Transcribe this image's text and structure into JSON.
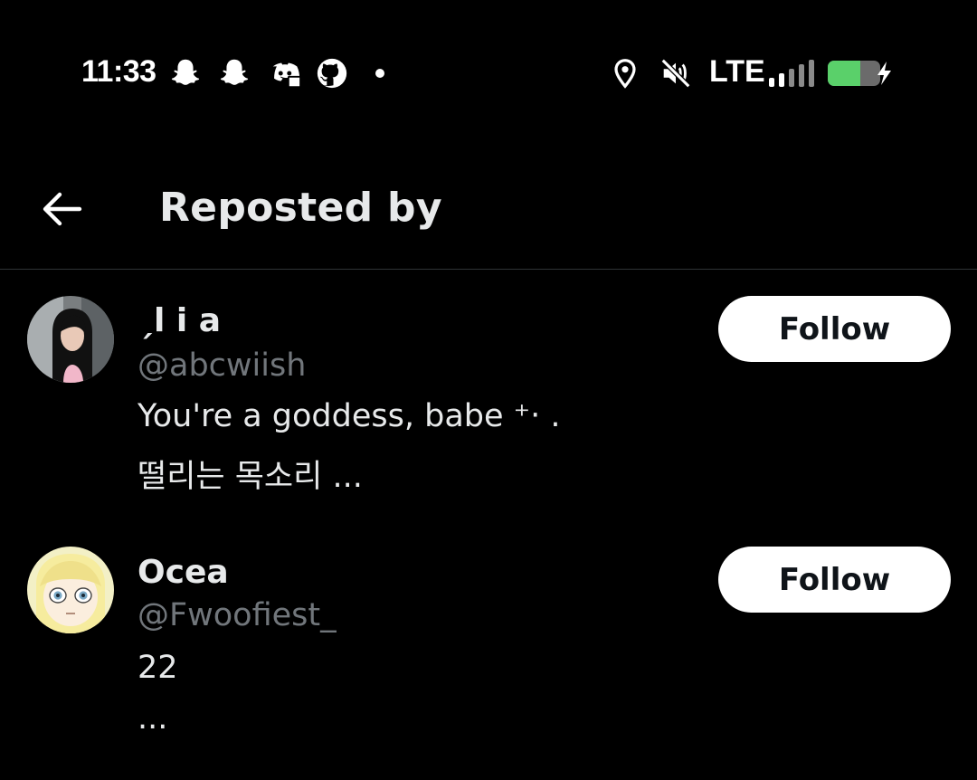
{
  "status_bar": {
    "time": "11:33",
    "left_icons": [
      "snapchat-icon",
      "snapchat-icon",
      "discord-icon",
      "github-icon",
      "notification-dot"
    ],
    "right_icons": [
      "location-icon",
      "mute-icon",
      "signal-icon",
      "battery-charging-icon"
    ],
    "network": "LTE",
    "battery_color": "#5ad06a"
  },
  "header": {
    "title": "Reposted by",
    "back_icon": "back-arrow-icon"
  },
  "users": [
    {
      "display_name": "ˏl i a",
      "handle": "@abcwiish",
      "bio": [
        "You're a goddess, babe ⁺‧ .",
        "떨리는 목소리 ..."
      ],
      "follow_label": "Follow"
    },
    {
      "display_name": "Ocea",
      "handle": "@Fwoofiest_",
      "bio": [
        "22",
        "..."
      ],
      "follow_label": "Follow"
    }
  ],
  "colors": {
    "background": "#000000",
    "primary_text": "#e7e9ea",
    "secondary_text": "#71767b",
    "divider": "#2f3336",
    "button_bg": "#ffffff",
    "button_text": "#0f1419"
  }
}
